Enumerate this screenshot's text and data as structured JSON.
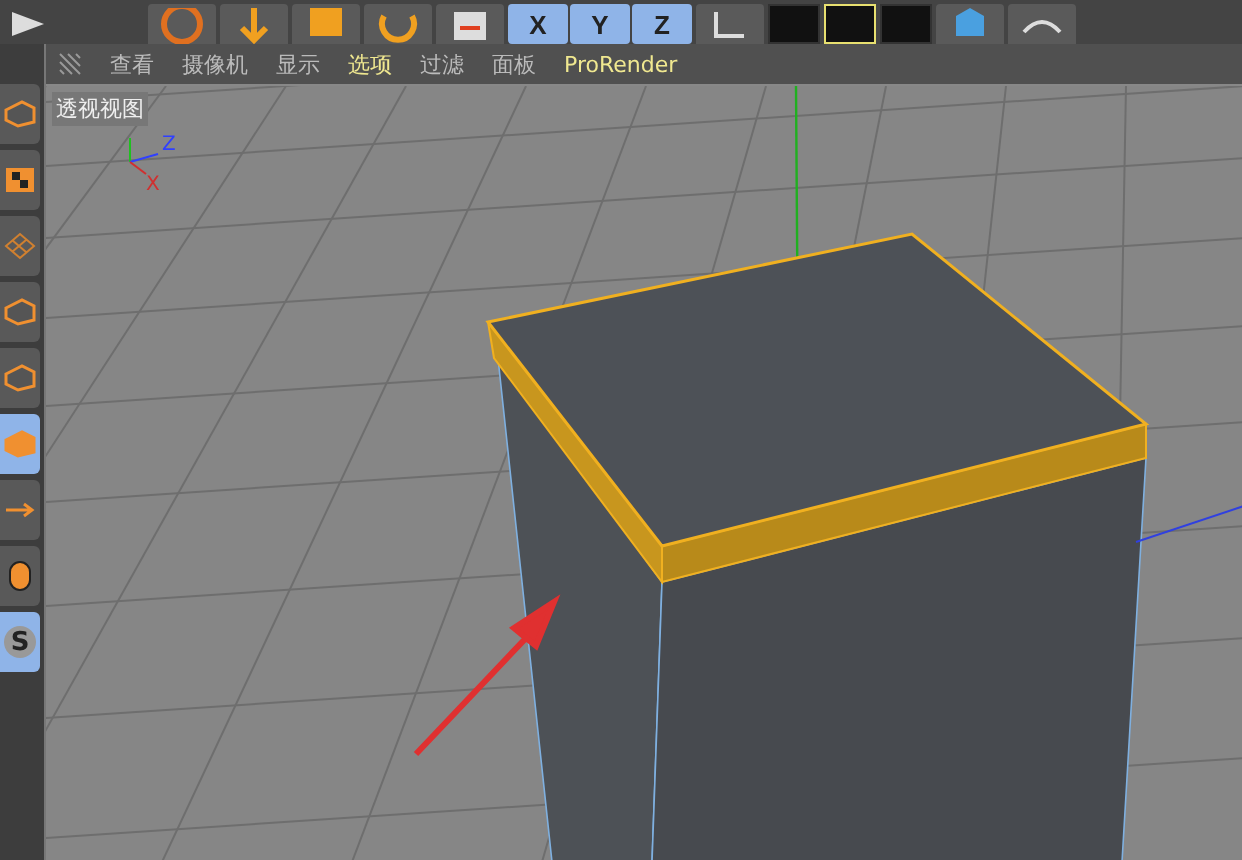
{
  "top_toolbar": {
    "axis_buttons": [
      {
        "label": "X",
        "selected": true
      },
      {
        "label": "Y",
        "selected": true
      },
      {
        "label": "Z",
        "selected": true
      }
    ]
  },
  "menu_bar": {
    "items": [
      {
        "label": "查看",
        "highlighted": false
      },
      {
        "label": "摄像机",
        "highlighted": false
      },
      {
        "label": "显示",
        "highlighted": false
      },
      {
        "label": "选项",
        "highlighted": true
      },
      {
        "label": "过滤",
        "highlighted": false
      },
      {
        "label": "面板",
        "highlighted": false
      },
      {
        "label": "ProRender",
        "highlighted": true
      }
    ]
  },
  "left_toolbar": [
    {
      "kind": "cube",
      "selected": false
    },
    {
      "kind": "checker",
      "selected": false
    },
    {
      "kind": "grid",
      "selected": false
    },
    {
      "kind": "points",
      "selected": false
    },
    {
      "kind": "edges",
      "selected": false
    },
    {
      "kind": "polygons",
      "selected": true
    },
    {
      "kind": "arrow",
      "selected": false
    },
    {
      "kind": "mouse",
      "selected": false
    },
    {
      "kind": "letter",
      "label": "S",
      "selected": true
    }
  ],
  "viewport": {
    "title": "透视视图",
    "axis_labels": [
      "Z",
      "X"
    ]
  }
}
